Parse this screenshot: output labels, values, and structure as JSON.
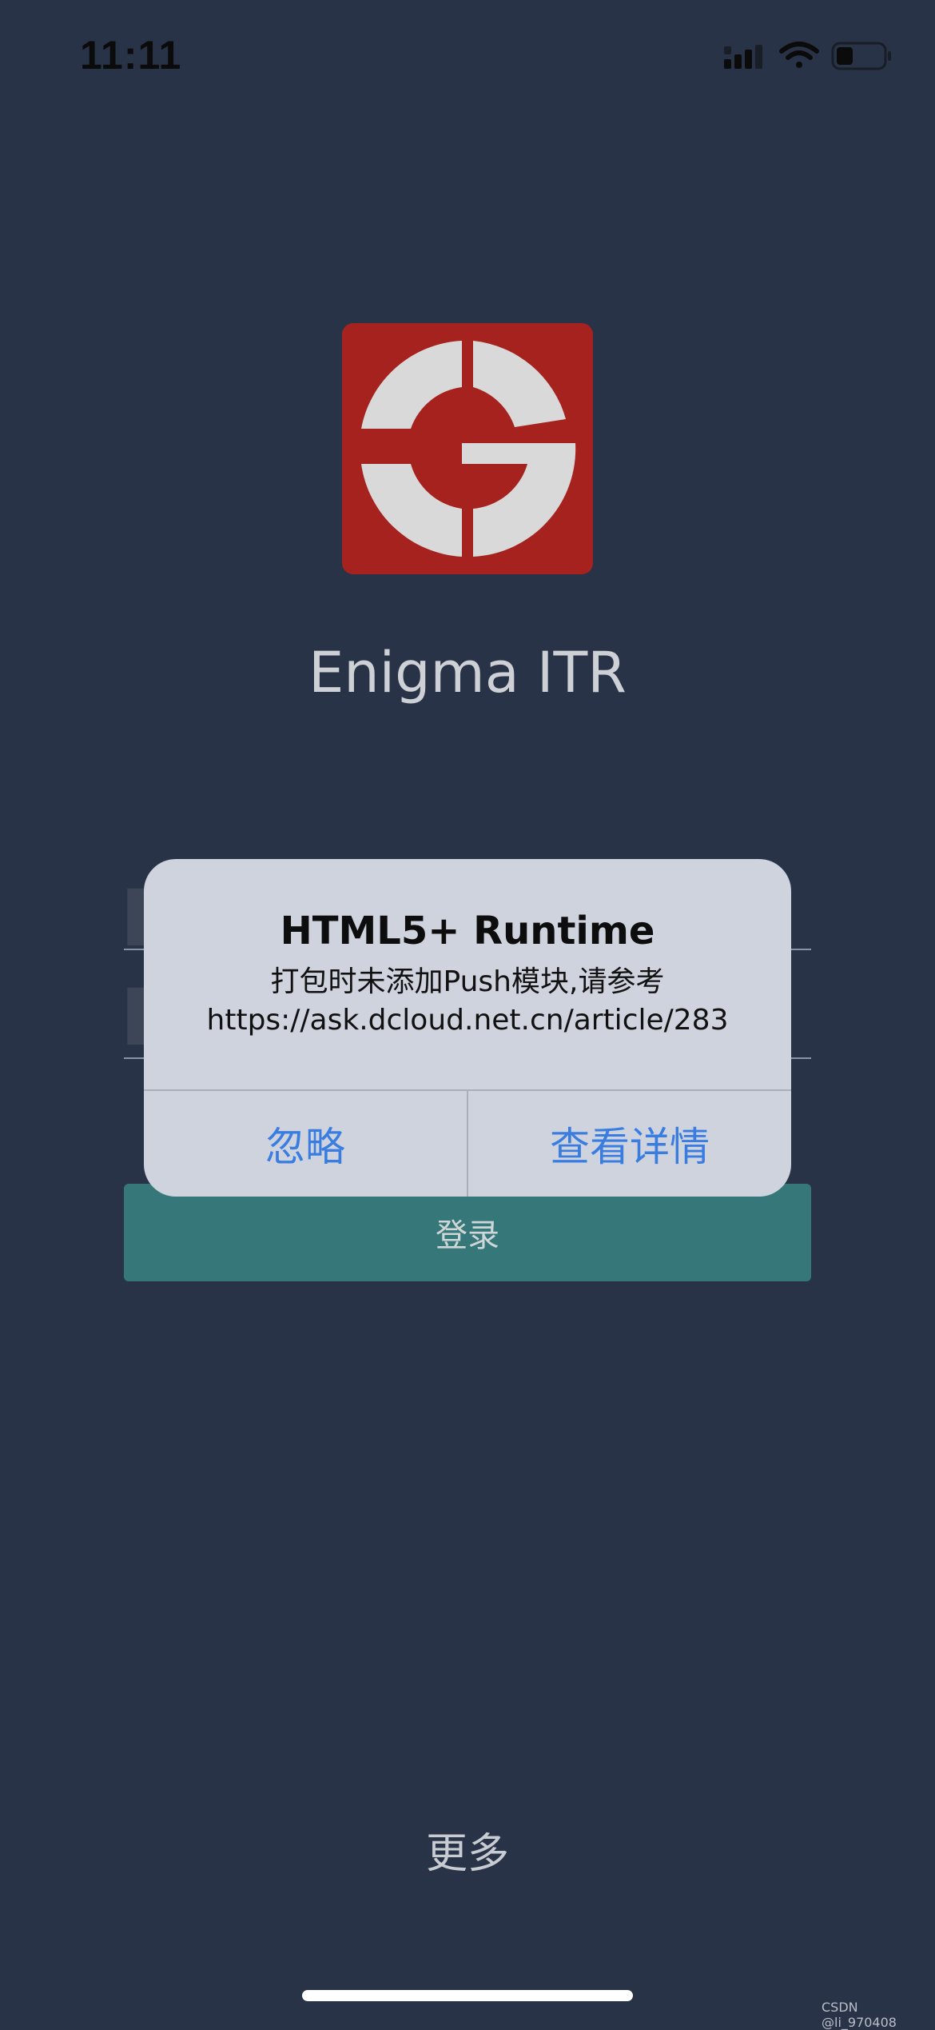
{
  "status_bar": {
    "time": "11:11"
  },
  "app": {
    "name": "Enigma ITR",
    "logo_colors": {
      "background": "#a6221e",
      "mark": "#d9d9d9"
    }
  },
  "login_form": {
    "submit_label": "登录",
    "more_label": "更多"
  },
  "alert": {
    "title": "HTML5+ Runtime",
    "message": "打包时未添加Push模块,请参考https://ask.dcloud.net.cn/article/283",
    "buttons": {
      "ignore": "忽略",
      "details": "查看详情"
    }
  },
  "watermark": "CSDN @li_970408",
  "colors": {
    "background": "#293347",
    "login_button": "#367879",
    "alert_background": "#ced3dd",
    "alert_button_text": "#3a7de1"
  },
  "icons": [
    "cellular-signal-icon",
    "wifi-icon",
    "battery-icon",
    "app-logo-icon"
  ]
}
